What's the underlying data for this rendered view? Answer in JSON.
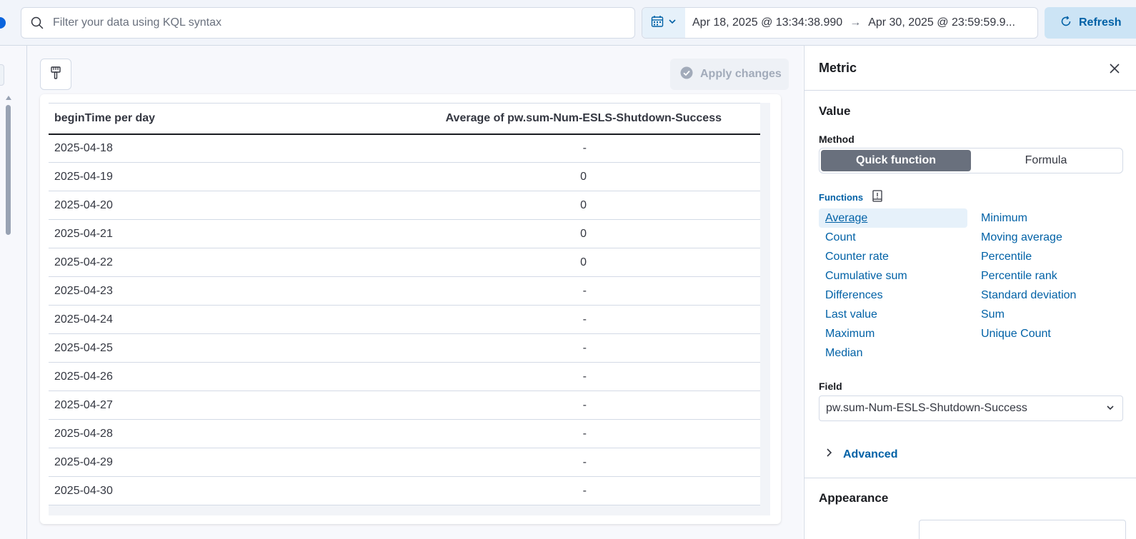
{
  "topbar": {
    "query_placeholder": "Filter your data using KQL syntax",
    "date_start": "Apr 18, 2025 @ 13:34:38.990",
    "date_arrow": "→",
    "date_end": "Apr 30, 2025 @ 23:59:59.9...",
    "refresh_label": "Refresh"
  },
  "workspace": {
    "apply_label": "Apply changes"
  },
  "table": {
    "headers": [
      "beginTime per day",
      "Average of pw.sum-Num-ESLS-Shutdown-Success"
    ],
    "rows": [
      [
        "2025-04-18",
        "-"
      ],
      [
        "2025-04-19",
        "0"
      ],
      [
        "2025-04-20",
        "0"
      ],
      [
        "2025-04-21",
        "0"
      ],
      [
        "2025-04-22",
        "0"
      ],
      [
        "2025-04-23",
        "-"
      ],
      [
        "2025-04-24",
        "-"
      ],
      [
        "2025-04-25",
        "-"
      ],
      [
        "2025-04-26",
        "-"
      ],
      [
        "2025-04-27",
        "-"
      ],
      [
        "2025-04-28",
        "-"
      ],
      [
        "2025-04-29",
        "-"
      ],
      [
        "2025-04-30",
        "-"
      ]
    ]
  },
  "panel": {
    "title": "Metric",
    "value_section": "Value",
    "method_label": "Method",
    "method_options": [
      "Quick function",
      "Formula"
    ],
    "method_selected": "Quick function",
    "functions_label": "Functions",
    "functions_left": [
      "Average",
      "Count",
      "Counter rate",
      "Cumulative sum",
      "Differences",
      "Last value",
      "Maximum",
      "Median"
    ],
    "functions_right": [
      "Minimum",
      "Moving average",
      "Percentile",
      "Percentile rank",
      "Standard deviation",
      "Sum",
      "Unique Count"
    ],
    "function_selected": "Average",
    "field_label": "Field",
    "field_value": "pw.sum-Num-ESLS-Shutdown-Success",
    "advanced_label": "Advanced",
    "appearance_label": "Appearance"
  },
  "colors": {
    "accent": "#0061a6",
    "toggle_active": "#69707d",
    "refresh_bg": "#cce4f5"
  },
  "icons": [
    "search-icon",
    "calendar-icon",
    "chevron-down-icon",
    "arrow-right-icon",
    "refresh-icon",
    "paintbrush-icon",
    "check-circle-icon",
    "close-icon",
    "documentation-icon",
    "chevron-right-icon"
  ]
}
